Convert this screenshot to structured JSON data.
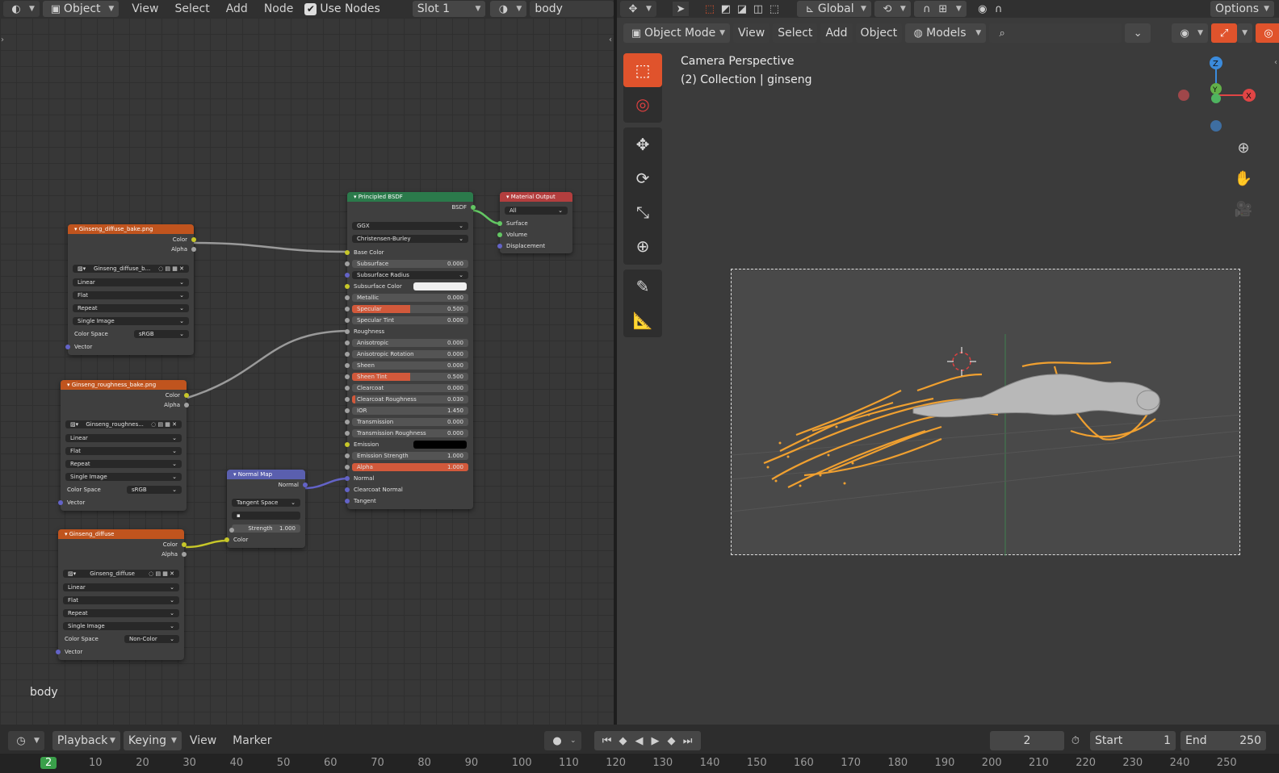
{
  "node_header": {
    "editor_icon": "node-editor-icon",
    "object_label": "Object",
    "menus": [
      "View",
      "Select",
      "Add",
      "Node"
    ],
    "use_nodes_label": "Use Nodes",
    "slot": "Slot 1",
    "material": "body"
  },
  "vp_header": {
    "mode": "Object Mode",
    "menus": [
      "View",
      "Select",
      "Add",
      "Object"
    ],
    "collection": "Models",
    "transform": "Global",
    "options": "Options"
  },
  "viewport": {
    "title": "Camera Perspective",
    "subtitle": "(2) Collection | ginseng"
  },
  "gizmo": {
    "z": "Z",
    "y": "Y",
    "x": "X"
  },
  "nodes": {
    "tex1": {
      "title": "Ginseng_diffuse_bake.png",
      "out_color": "Color",
      "out_alpha": "Alpha",
      "image": "Ginseng_diffuse_b...",
      "interp": "Linear",
      "proj": "Flat",
      "ext": "Repeat",
      "src": "Single Image",
      "cs_label": "Color Space",
      "cs": "sRGB",
      "vector": "Vector"
    },
    "tex2": {
      "title": "Ginseng_roughness_bake.png",
      "out_color": "Color",
      "out_alpha": "Alpha",
      "image": "Ginseng_roughnes...",
      "interp": "Linear",
      "proj": "Flat",
      "ext": "Repeat",
      "src": "Single Image",
      "cs_label": "Color Space",
      "cs": "sRGB",
      "vector": "Vector"
    },
    "tex3": {
      "title": "Ginseng_diffuse",
      "out_color": "Color",
      "out_alpha": "Alpha",
      "image": "Ginseng_diffuse",
      "interp": "Linear",
      "proj": "Flat",
      "ext": "Repeat",
      "src": "Single Image",
      "cs_label": "Color Space",
      "cs": "Non-Color",
      "vector": "Vector"
    },
    "normal": {
      "title": "Normal Map",
      "out": "Normal",
      "space": "Tangent Space",
      "strength_label": "Strength",
      "strength": "1.000",
      "color": "Color"
    },
    "bsdf": {
      "title": "Principled BSDF",
      "out": "BSDF",
      "dist": "GGX",
      "sss": "Christensen-Burley",
      "rows": [
        {
          "l": "Base Color",
          "k": "label"
        },
        {
          "l": "Subsurface",
          "v": "0.000"
        },
        {
          "l": "Subsurface Radius",
          "k": "drop"
        },
        {
          "l": "Subsurface Color",
          "k": "white"
        },
        {
          "l": "Metallic",
          "v": "0.000"
        },
        {
          "l": "Specular",
          "v": "0.500",
          "f": 0.5
        },
        {
          "l": "Specular Tint",
          "v": "0.000"
        },
        {
          "l": "Roughness",
          "k": "label"
        },
        {
          "l": "Anisotropic",
          "v": "0.000"
        },
        {
          "l": "Anisotropic Rotation",
          "v": "0.000"
        },
        {
          "l": "Sheen",
          "v": "0.000"
        },
        {
          "l": "Sheen Tint",
          "v": "0.500",
          "f": 0.5
        },
        {
          "l": "Clearcoat",
          "v": "0.000"
        },
        {
          "l": "Clearcoat Roughness",
          "v": "0.030",
          "f": 0.03
        },
        {
          "l": "IOR",
          "v": "1.450"
        },
        {
          "l": "Transmission",
          "v": "0.000"
        },
        {
          "l": "Transmission Roughness",
          "v": "0.000"
        },
        {
          "l": "Emission",
          "k": "black"
        },
        {
          "l": "Emission Strength",
          "v": "1.000"
        },
        {
          "l": "Alpha",
          "v": "1.000",
          "f": 1
        },
        {
          "l": "Normal",
          "k": "label"
        },
        {
          "l": "Clearcoat Normal",
          "k": "label"
        },
        {
          "l": "Tangent",
          "k": "label"
        }
      ]
    },
    "output": {
      "title": "Material Output",
      "target": "All",
      "surface": "Surface",
      "volume": "Volume",
      "displacement": "Displacement"
    }
  },
  "editor_label": "body",
  "timeline": {
    "menus": [
      "Playback",
      "Keying",
      "View",
      "Marker"
    ],
    "frame": "2",
    "start_label": "Start",
    "start": "1",
    "end_label": "End",
    "end": "250"
  },
  "ruler": [
    "2",
    "10",
    "20",
    "30",
    "40",
    "50",
    "60",
    "70",
    "80",
    "90",
    "100",
    "110",
    "120",
    "130",
    "140",
    "150",
    "160",
    "170",
    "180",
    "190",
    "200",
    "210",
    "220",
    "230",
    "240",
    "250"
  ],
  "colors": {
    "accent": "#e0532c",
    "texture_header": "#c0541e",
    "shader_header": "#2b7a4b",
    "output_header": "#b33e3e",
    "vector_header": "#5a5fae",
    "root": "#f0a030"
  }
}
